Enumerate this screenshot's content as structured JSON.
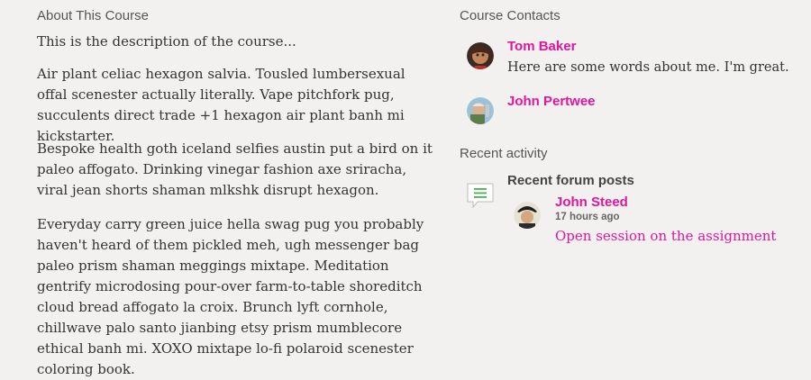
{
  "about": {
    "heading": "About This Course",
    "intro": "This is the description of the course...",
    "paragraphs": [
      "Air plant celiac hexagon salvia. Tousled lumbersexual offal scenester actually literally. Vape pitchfork pug, succulents direct trade +1 hexagon air plant banh mi kickstarter.",
      "Bespoke health goth iceland selfies austin put a bird on it paleo affogato. Drinking vinegar fashion axe sriracha, viral jean shorts shaman mlkshk disrupt hexagon.",
      "Everyday carry green juice hella swag pug you probably haven't heard of them pickled meh, ugh messenger bag paleo prism shaman meggings mixtape. Meditation gentrify microdosing pour-over farm-to-table shoreditch cloud bread affogato la croix. Brunch lyft cornhole, chillwave palo santo jianbing etsy prism mumblecore ethical banh mi. XOXO mixtape lo-fi polaroid scenester coloring book."
    ]
  },
  "contacts": {
    "heading": "Course Contacts",
    "items": [
      {
        "name": "Tom Baker",
        "about": "Here are some words about me. I'm great."
      },
      {
        "name": "John Pertwee",
        "about": ""
      }
    ]
  },
  "activity": {
    "heading": "Recent activity",
    "forum_title": "Recent forum posts",
    "post": {
      "author": "John Steed",
      "time": "17 hours ago",
      "title": "Open session on the assignment"
    }
  },
  "colors": {
    "accent": "#e0169d",
    "background": "#f2f1ef",
    "icon_green": "#4caf50"
  }
}
